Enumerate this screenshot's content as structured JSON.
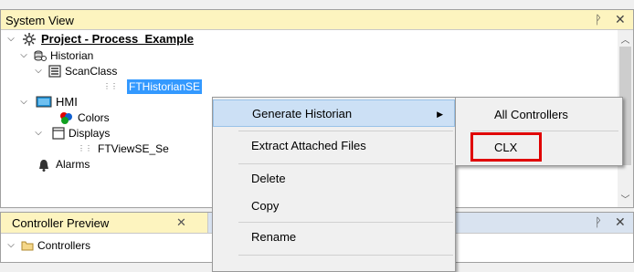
{
  "system_view": {
    "title": "System View",
    "pin_glyph": "ᚹ",
    "close_glyph": "✕",
    "tree": {
      "project": "Project - Process_Example",
      "historian": "Historian",
      "scanclass": "ScanClass",
      "ft_historian_se": "FTHistorianSE",
      "hmi": "HMI",
      "colors": "Colors",
      "displays": "Displays",
      "ftview_se": "FTViewSE_Se",
      "alarms": "Alarms"
    }
  },
  "controller_preview": {
    "title": "Controller Preview",
    "close_glyph": "✕",
    "tree": {
      "controllers": "Controllers"
    }
  },
  "context_menu": {
    "items": [
      "Generate Historian",
      "Extract Attached Files",
      "Delete",
      "Copy",
      "Rename"
    ],
    "submenu_arrow": "▶"
  },
  "submenu": {
    "items": [
      "All Controllers",
      "CLX"
    ]
  },
  "colors": {
    "panel_title_bg": "#fdf4bf",
    "highlight": "#cce0f5",
    "selection": "#3399ff",
    "red_box": "#e00000"
  }
}
